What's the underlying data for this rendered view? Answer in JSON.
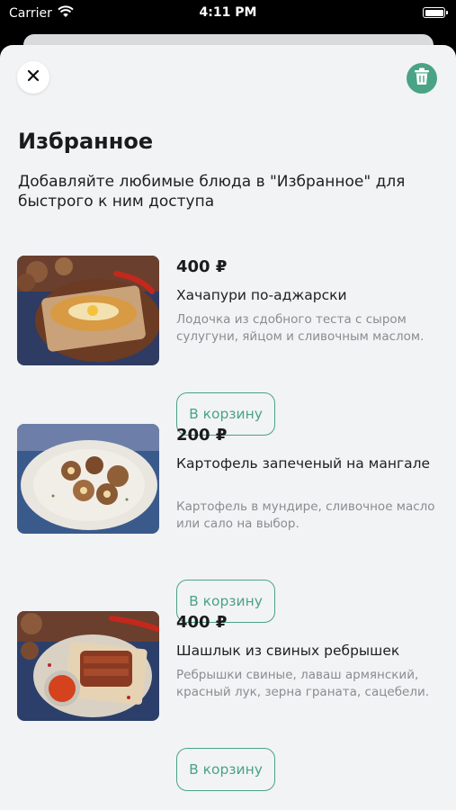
{
  "status_bar": {
    "carrier": "Carrier",
    "time": "4:11 PM"
  },
  "header": {
    "close_icon": "close-icon",
    "trash_icon": "trash-icon",
    "title": "Избранное",
    "subtitle": "Добавляйте любимые блюда в \"Избранное\" для быстрого к ним доступа"
  },
  "items": [
    {
      "price": "400 ₽",
      "name": "Хачапури по-аджарски",
      "description": "Лодочка из сдобного теста с сыром сулугуни, яйцом и сливочным маслом.",
      "button": "В корзину"
    },
    {
      "price": "200 ₽",
      "name": "Картофель запеченый на мангале",
      "description": "Картофель в мундире, сливочное масло или сало на выбор.",
      "button": "В корзину"
    },
    {
      "price": "400 ₽",
      "name": "Шашлык из свиных ребрышек",
      "description": "Ребрышки свиные, лаваш армянский, красный лук, зерна граната, сацебели.",
      "button": "В корзину"
    }
  ],
  "colors": {
    "accent": "#4aa385",
    "background": "#f2f3f5",
    "muted_text": "#8a8c8f"
  }
}
